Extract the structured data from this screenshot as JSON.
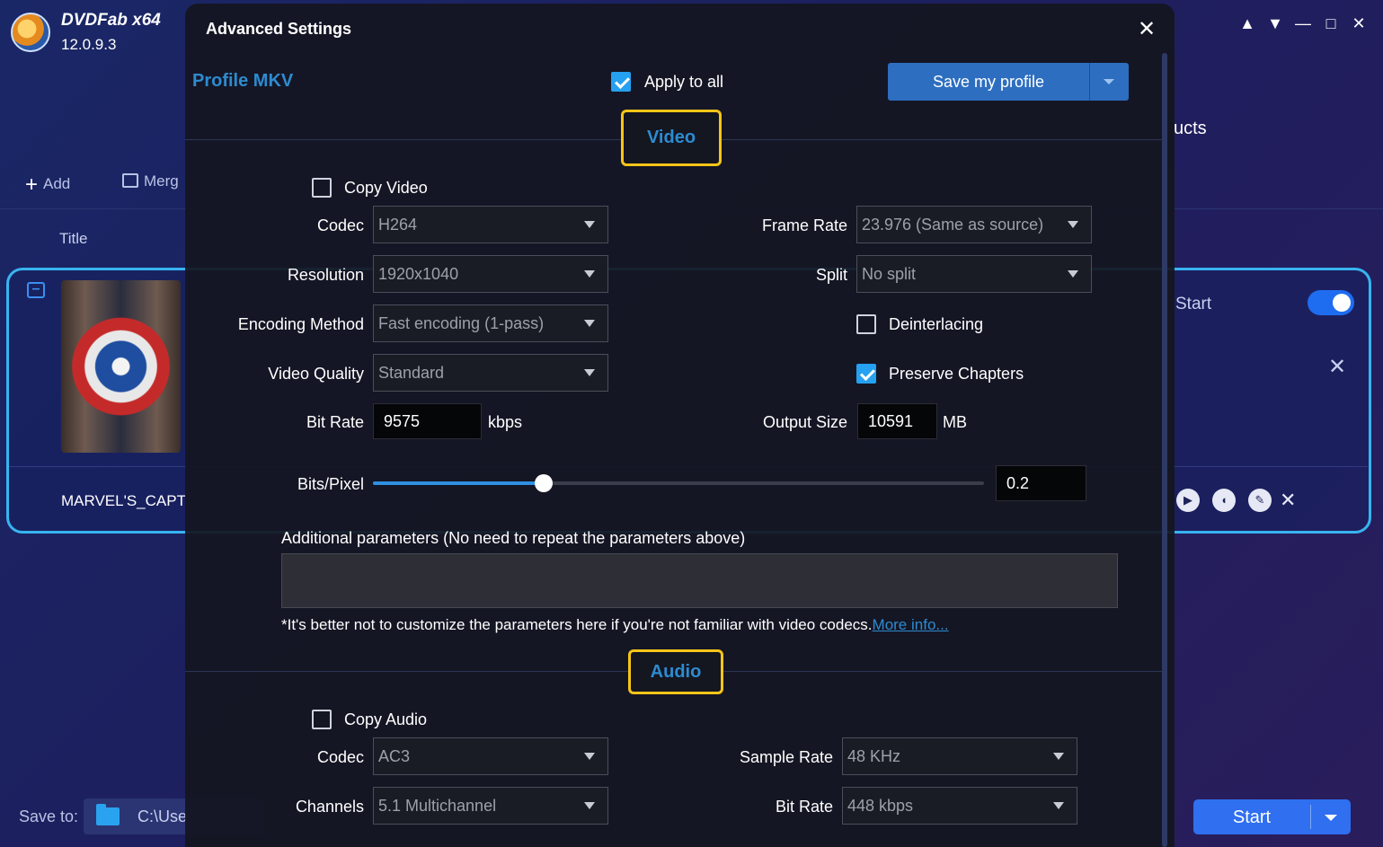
{
  "app": {
    "name": "DVDFab x64",
    "version": "12.0.9.3",
    "products_tail": "ucts",
    "toolbar": {
      "add": "Add",
      "merge": "Merg"
    },
    "column_title": "Title",
    "task": {
      "name": "MARVEL'S_CAPT",
      "start_label": "Start",
      "start_toggle_on": true
    },
    "save_to": {
      "label": "Save to:",
      "path": "C:\\Use"
    },
    "start_button": "Start"
  },
  "dialog": {
    "title": "Advanced Settings",
    "profile": "Profile MKV",
    "apply_to_all": {
      "label": "Apply to all",
      "checked": true
    },
    "save_profile": "Save my profile",
    "video": {
      "section": "Video",
      "copy_video": {
        "label": "Copy Video",
        "checked": false
      },
      "codec": {
        "label": "Codec",
        "value": "H264"
      },
      "resolution": {
        "label": "Resolution",
        "value": "1920x1040"
      },
      "encoding_method": {
        "label": "Encoding Method",
        "value": "Fast encoding (1-pass)"
      },
      "video_quality": {
        "label": "Video Quality",
        "value": "Standard"
      },
      "bit_rate": {
        "label": "Bit Rate",
        "value": "9575",
        "unit": "kbps"
      },
      "frame_rate": {
        "label": "Frame Rate",
        "value": "23.976 (Same as source)"
      },
      "split": {
        "label": "Split",
        "value": "No split"
      },
      "deinterlacing": {
        "label": "Deinterlacing",
        "checked": false
      },
      "preserve_chapters": {
        "label": "Preserve Chapters",
        "checked": true
      },
      "output_size": {
        "label": "Output Size",
        "value": "10591",
        "unit": "MB"
      },
      "bits_per_pixel": {
        "label": "Bits/Pixel",
        "value": "0.2",
        "slider_fraction": 0.28
      },
      "additional_params_label": "Additional parameters (No need to repeat the parameters above)",
      "additional_params_value": "",
      "note": "*It's better not to customize the parameters here if you're not familiar with video codecs.",
      "more_info": "More info..."
    },
    "audio": {
      "section": "Audio",
      "copy_audio": {
        "label": "Copy Audio",
        "checked": false
      },
      "codec": {
        "label": "Codec",
        "value": "AC3"
      },
      "channels": {
        "label": "Channels",
        "value": "5.1 Multichannel"
      },
      "sample_rate": {
        "label": "Sample Rate",
        "value": "48 KHz"
      },
      "bit_rate": {
        "label": "Bit Rate",
        "value": "448 kbps"
      }
    }
  },
  "colors": {
    "accent_blue": "#2d8bd0",
    "highlight_yellow": "#f5c518",
    "checkbox_blue": "#26a0f0"
  }
}
